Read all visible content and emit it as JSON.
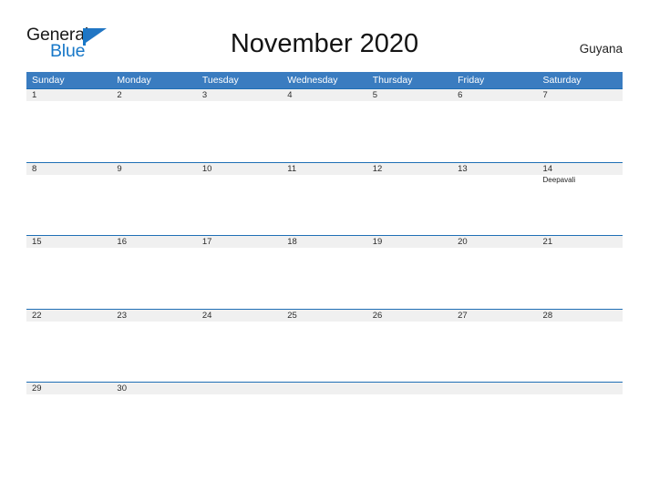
{
  "brand": {
    "name_part1": "General",
    "name_part2": "Blue",
    "color_primary": "#1878c8",
    "triangle_icon": "triangle-flag-icon"
  },
  "header": {
    "title": "November 2020",
    "country": "Guyana"
  },
  "calendar": {
    "colors": {
      "header_blue": "#3a7cc0",
      "row_border_blue": "#1f6fb5",
      "day_band_gray": "#f0f0f0",
      "text_dark": "#2b2b2b"
    },
    "weekdays": [
      "Sunday",
      "Monday",
      "Tuesday",
      "Wednesday",
      "Thursday",
      "Friday",
      "Saturday"
    ],
    "weeks": [
      {
        "days": [
          {
            "num": "1",
            "events": []
          },
          {
            "num": "2",
            "events": []
          },
          {
            "num": "3",
            "events": []
          },
          {
            "num": "4",
            "events": []
          },
          {
            "num": "5",
            "events": []
          },
          {
            "num": "6",
            "events": []
          },
          {
            "num": "7",
            "events": []
          }
        ]
      },
      {
        "days": [
          {
            "num": "8",
            "events": []
          },
          {
            "num": "9",
            "events": []
          },
          {
            "num": "10",
            "events": []
          },
          {
            "num": "11",
            "events": []
          },
          {
            "num": "12",
            "events": []
          },
          {
            "num": "13",
            "events": []
          },
          {
            "num": "14",
            "events": [
              "Deepavali"
            ]
          }
        ]
      },
      {
        "days": [
          {
            "num": "15",
            "events": []
          },
          {
            "num": "16",
            "events": []
          },
          {
            "num": "17",
            "events": []
          },
          {
            "num": "18",
            "events": []
          },
          {
            "num": "19",
            "events": []
          },
          {
            "num": "20",
            "events": []
          },
          {
            "num": "21",
            "events": []
          }
        ]
      },
      {
        "days": [
          {
            "num": "22",
            "events": []
          },
          {
            "num": "23",
            "events": []
          },
          {
            "num": "24",
            "events": []
          },
          {
            "num": "25",
            "events": []
          },
          {
            "num": "26",
            "events": []
          },
          {
            "num": "27",
            "events": []
          },
          {
            "num": "28",
            "events": []
          }
        ]
      },
      {
        "days": [
          {
            "num": "29",
            "events": []
          },
          {
            "num": "30",
            "events": []
          },
          {
            "num": "",
            "events": []
          },
          {
            "num": "",
            "events": []
          },
          {
            "num": "",
            "events": []
          },
          {
            "num": "",
            "events": []
          },
          {
            "num": "",
            "events": []
          }
        ]
      }
    ]
  }
}
